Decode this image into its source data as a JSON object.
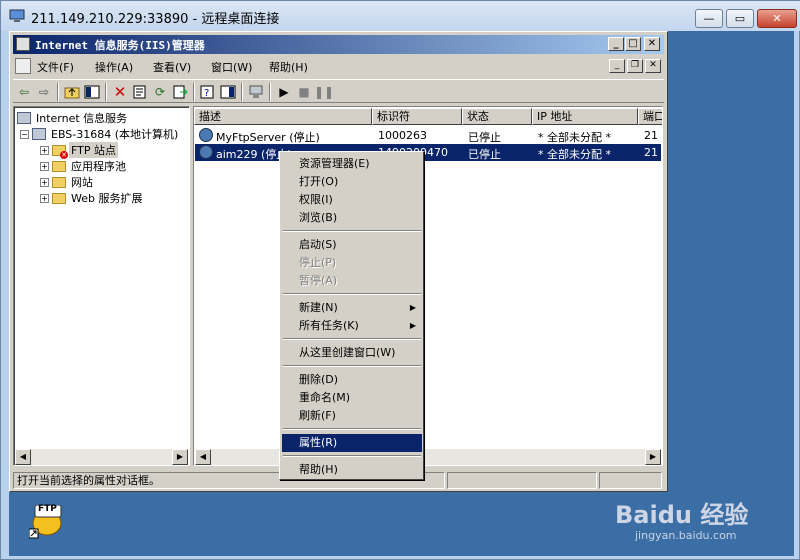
{
  "rdp": {
    "title": "211.149.210.229:33890 - 远程桌面连接",
    "min": "—",
    "max": "▭",
    "close": "✕"
  },
  "iis": {
    "title": "Internet 信息服务(IIS)管理器",
    "controls": {
      "min": "_",
      "max": "□",
      "close": "✕"
    },
    "mdi": {
      "min": "_",
      "restore": "❐",
      "close": "✕"
    }
  },
  "menu": [
    "文件(F)",
    "操作(A)",
    "查看(V)",
    "窗口(W)",
    "帮助(H)"
  ],
  "tree": {
    "root": "Internet 信息服务",
    "server": "EBS-31684 (本地计算机)",
    "children": [
      "FTP 站点",
      "应用程序池",
      "网站",
      "Web 服务扩展"
    ]
  },
  "list": {
    "columns": [
      "描述",
      "标识符",
      "状态",
      "IP 地址",
      "端口"
    ],
    "rows": [
      [
        "MyFtpServer (停止)",
        "1000263",
        "已停止",
        "* 全部未分配 *",
        "21"
      ],
      [
        "aim229 (停止)",
        "1490209470",
        "已停止",
        "* 全部未分配 *",
        "21"
      ]
    ]
  },
  "context_menu": {
    "groups": [
      [
        {
          "label": "资源管理器(E)"
        },
        {
          "label": "打开(O)"
        },
        {
          "label": "权限(I)"
        },
        {
          "label": "浏览(B)"
        }
      ],
      [
        {
          "label": "启动(S)"
        },
        {
          "label": "停止(P)",
          "disabled": true
        },
        {
          "label": "暂停(A)",
          "disabled": true
        }
      ],
      [
        {
          "label": "新建(N)",
          "submenu": true
        },
        {
          "label": "所有任务(K)",
          "submenu": true
        }
      ],
      [
        {
          "label": "从这里创建窗口(W)"
        }
      ],
      [
        {
          "label": "删除(D)"
        },
        {
          "label": "重命名(M)"
        },
        {
          "label": "刷新(F)"
        }
      ],
      [
        {
          "label": "属性(R)",
          "highlighted": true
        }
      ],
      [
        {
          "label": "帮助(H)"
        }
      ]
    ]
  },
  "status": "打开当前选择的属性对话框。",
  "desktop_icon": "FTP",
  "watermark": {
    "brand": "Baidu 经验",
    "url": "jingyan.baidu.com"
  },
  "colors": {
    "selection": "#0a246a",
    "desktop": "#3a6ea5",
    "face": "#d4d0c8"
  }
}
